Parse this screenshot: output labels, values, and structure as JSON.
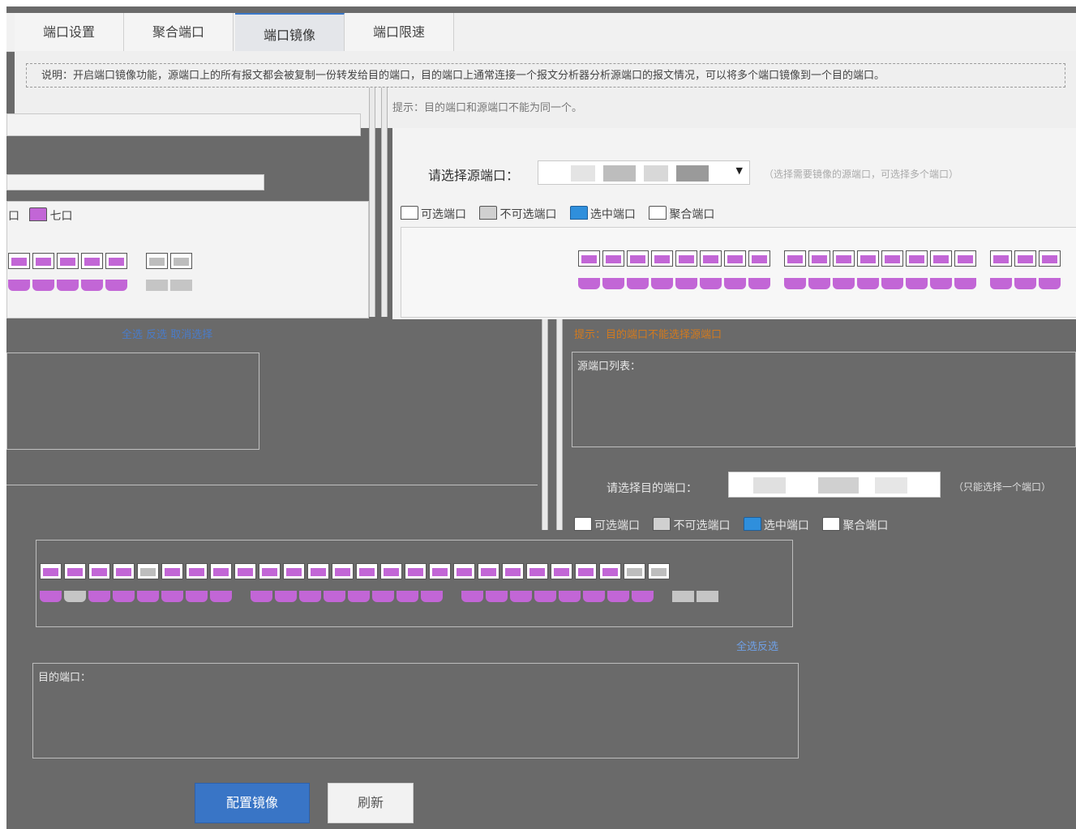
{
  "tabs": [
    {
      "label": "端口设置",
      "active": false
    },
    {
      "label": "聚合端口",
      "active": false
    },
    {
      "label": "端口镜像",
      "active": true
    },
    {
      "label": "端口限速",
      "active": false
    }
  ],
  "notice": "说明：开启端口镜像功能，源端口上的所有报文都会被复制一份转发给目的端口，目的端口上通常连接一个报文分析器分析源端口的报文情况，可以将多个端口镜像到一个目的端口。",
  "hint": "提示：目的端口和源端口不能为同一个。",
  "source": {
    "label": "请选择源端口：",
    "help": "（选择需要镜像的源端口，可选择多个端口）"
  },
  "legend": {
    "selectable": "可选端口",
    "unselectable": "不可选端口",
    "selected": "选中端口",
    "aggregate": "聚合端口",
    "left_partial_a": "口",
    "left_partial_b": "七口"
  },
  "links": {
    "select_all_left": "全选  反选  取消选择",
    "dest_select_all": "全选反选"
  },
  "warning": "提示：目的端口不能选择源端口",
  "selected_list_label": "源端口列表：",
  "dest": {
    "label": "请选择目的端口：",
    "help": "（只能选择一个端口）"
  },
  "dest_list_label": "目的端口：",
  "buttons": {
    "apply": "配置镜像",
    "refresh": "刷新"
  },
  "colors": {
    "accent": "#3975c6",
    "port_magenta": "#c266d6",
    "selected_icon": "#2f8fdc",
    "warning": "#d27a1e"
  },
  "icons": [
    "selectable-port-icon",
    "unselectable-port-icon",
    "selected-port-icon",
    "aggregate-port-icon",
    "caret-down-icon"
  ]
}
